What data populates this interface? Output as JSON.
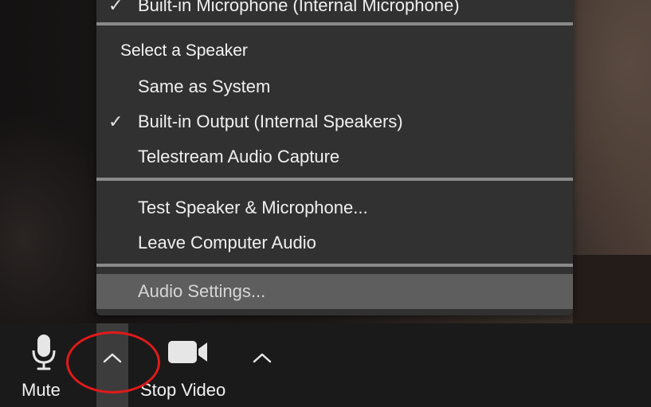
{
  "menu": {
    "top_item": {
      "label": "Built-in Microphone (Internal Microphone)",
      "checked": true
    },
    "speaker_header": "Select a Speaker",
    "speakers": [
      {
        "label": "Same as System",
        "checked": false
      },
      {
        "label": "Built-in Output (Internal Speakers)",
        "checked": true
      },
      {
        "label": "Telestream Audio Capture",
        "checked": false
      }
    ],
    "actions": [
      {
        "label": "Test Speaker & Microphone..."
      },
      {
        "label": "Leave Computer Audio"
      }
    ],
    "settings": {
      "label": "Audio Settings...",
      "highlighted": true
    }
  },
  "toolbar": {
    "mute": {
      "label": "Mute",
      "icon": "microphone-icon"
    },
    "audio_options": {
      "icon": "chevron-up-icon"
    },
    "video": {
      "label": "Stop Video",
      "icon": "video-camera-icon"
    },
    "video_options": {
      "icon": "chevron-up-icon"
    }
  },
  "annotation": {
    "color": "#e01a1a"
  },
  "colors": {
    "menu_bg": "#313131",
    "separator": "#8a8a8a",
    "highlight": "#5e5e5e",
    "toolbar_bg": "#1a1a1a"
  }
}
